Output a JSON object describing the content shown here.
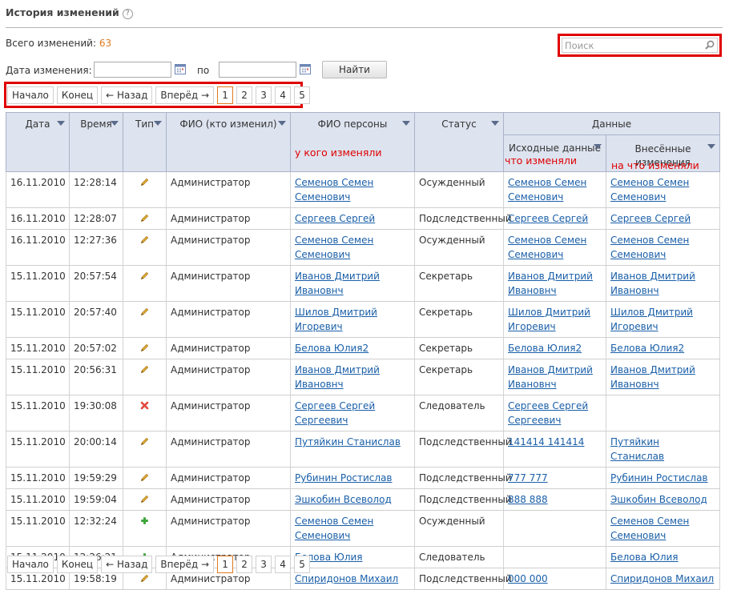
{
  "header": {
    "title": "История изменений",
    "help_glyph": "?"
  },
  "summary": {
    "label": "Всего изменений:",
    "count": "63"
  },
  "search": {
    "placeholder": "Поиск",
    "icon": "search-icon"
  },
  "filter": {
    "date_label": "Дата изменения: с",
    "to_label": "по",
    "find_label": "Найти",
    "from_value": "",
    "to_value": ""
  },
  "pager": {
    "first": "Начало",
    "last": "Конец",
    "back": "← Назад",
    "forward": "Вперёд →",
    "pages": [
      "1",
      "2",
      "3",
      "4",
      "5"
    ],
    "current": "1"
  },
  "columns": {
    "date": "Дата",
    "time": "Время",
    "type": "Тип",
    "editor": "ФИО (кто изменил)",
    "person": "ФИО персоны",
    "status": "Статус",
    "data": "Данные",
    "original": "Исходные данные",
    "changed": "Внесённые изменения"
  },
  "annotations": {
    "who_changed": "у кого изменяли",
    "what_changed": "что изменяли",
    "to_what": "на что изменяли",
    "color": "#e00000"
  },
  "icons": {
    "edit": "pencil-icon",
    "delete": "delete-cross-icon",
    "add": "plus-icon"
  },
  "colors": {
    "accent": "#e07a1f",
    "link": "#1a5fa8",
    "header_bg": "#dde3ef",
    "highlight": "#e00000"
  },
  "rows": [
    {
      "date": "16.11.2010",
      "time": "12:28:14",
      "type": "edit",
      "editor": "Администратор",
      "person": "Семенов Семен Семенович",
      "status": "Осужденный",
      "original": "Семенов Семен Семенович",
      "changed": "Семенов Семен Семенович"
    },
    {
      "date": "16.11.2010",
      "time": "12:28:07",
      "type": "edit",
      "editor": "Администратор",
      "person": "Сергеев Сергей",
      "status": "Подследственный",
      "original": "Сергеев Сергей",
      "changed": "Сергеев Сергей"
    },
    {
      "date": "16.11.2010",
      "time": "12:27:36",
      "type": "edit",
      "editor": "Администратор",
      "person": "Семенов Семен Семенович",
      "status": "Осужденный",
      "original": "Семенов Семен Семенович",
      "changed": "Семенов Семен Семенович"
    },
    {
      "date": "15.11.2010",
      "time": "20:57:54",
      "type": "edit",
      "editor": "Администратор",
      "person": "Иванов Дмитрий Ивановнч",
      "status": "Секретарь",
      "original": "Иванов Дмитрий Ивановнч",
      "changed": "Иванов Дмитрий Ивановнч"
    },
    {
      "date": "15.11.2010",
      "time": "20:57:40",
      "type": "edit",
      "editor": "Администратор",
      "person": "Шилов Дмитрий Игоревич",
      "status": "Секретарь",
      "original": "Шилов Дмитрий Игоревич",
      "changed": "Шилов Дмитрий Игоревич"
    },
    {
      "date": "15.11.2010",
      "time": "20:57:02",
      "type": "edit",
      "editor": "Администратор",
      "person": "Белова Юлия2",
      "status": "Секретарь",
      "original": "Белова Юлия2",
      "changed": "Белова Юлия2"
    },
    {
      "date": "15.11.2010",
      "time": "20:56:31",
      "type": "edit",
      "editor": "Администратор",
      "person": "Иванов Дмитрий Ивановнч",
      "status": "Секретарь",
      "original": "Иванов Дмитрий Ивановнч",
      "changed": "Иванов Дмитрий Ивановнч"
    },
    {
      "date": "15.11.2010",
      "time": "19:30:08",
      "type": "delete",
      "editor": "Администратор",
      "person": "Сергеев Сергей Сергеевич",
      "status": "Следователь",
      "original": "Сергеев Сергей Сергеевич",
      "changed": ""
    },
    {
      "date": "15.11.2010",
      "time": "20:00:14",
      "type": "edit",
      "editor": "Администратор",
      "person": "Путяйкин Станислав",
      "status": "Подследственный",
      "original": "141414 141414",
      "changed": "Путяйкин Станислав"
    },
    {
      "date": "15.11.2010",
      "time": "19:59:29",
      "type": "edit",
      "editor": "Администратор",
      "person": "Рубинин Ростислав",
      "status": "Подследственный",
      "original": "777 777",
      "changed": "Рубинин Ростислав"
    },
    {
      "date": "15.11.2010",
      "time": "19:59:04",
      "type": "edit",
      "editor": "Администратор",
      "person": "Эшкобин Всеволод",
      "status": "Подследственный",
      "original": "888 888",
      "changed": "Эшкобин Всеволод"
    },
    {
      "date": "15.11.2010",
      "time": "12:32:24",
      "type": "add",
      "editor": "Администратор",
      "person": "Семенов Семен Семенович",
      "status": "Осужденный",
      "original": "",
      "changed": "Семенов Семен Семенович"
    },
    {
      "date": "15.11.2010",
      "time": "12:26:21",
      "type": "add",
      "editor": "Администратор",
      "person": "Белова Юлия",
      "status": "Следователь",
      "original": "",
      "changed": "Белова Юлия"
    },
    {
      "date": "15.11.2010",
      "time": "19:58:19",
      "type": "edit",
      "editor": "Администратор",
      "person": "Спиридонов Михаил",
      "status": "Подследственный",
      "original": "000 000",
      "changed": "Спиридонов Михаил"
    }
  ]
}
